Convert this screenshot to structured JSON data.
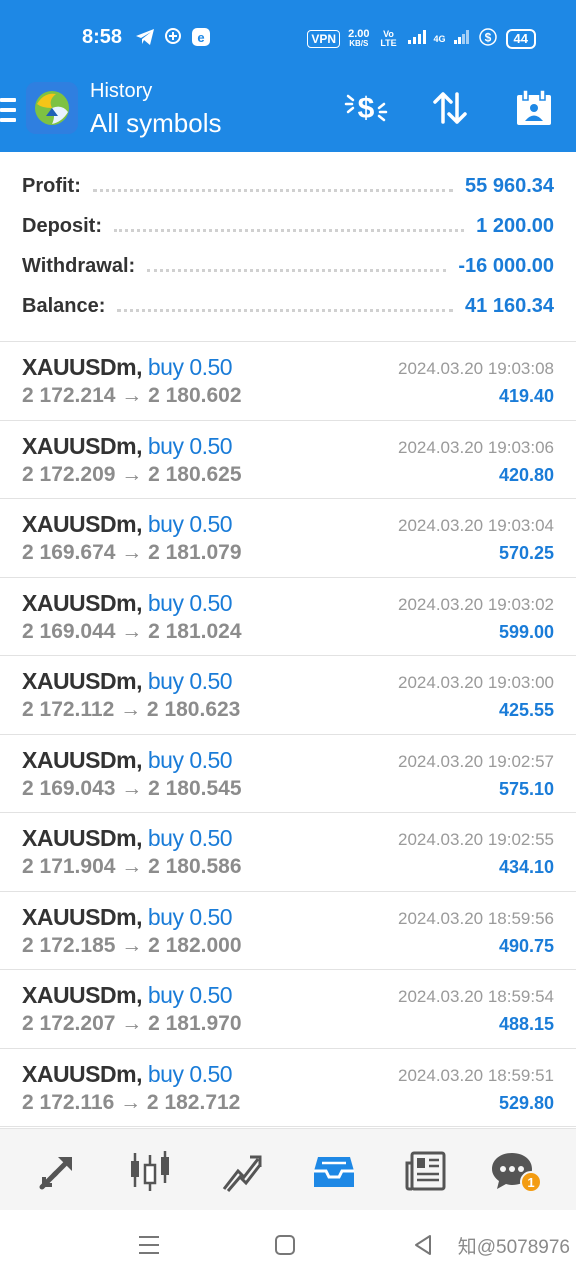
{
  "status_bar": {
    "time": "8:58",
    "vpn": "VPN",
    "speed_value": "2.00",
    "speed_unit": "KB/S",
    "network": "Vo LTE",
    "network2": "4G",
    "battery": "44"
  },
  "header": {
    "title": "History",
    "subtitle": "All symbols",
    "icons": [
      "deposit-filter-icon",
      "sort-icon",
      "calendar-icon"
    ]
  },
  "summary": {
    "profit_label": "Profit:",
    "profit_value": "55 960.34",
    "deposit_label": "Deposit:",
    "deposit_value": "1 200.00",
    "withdrawal_label": "Withdrawal:",
    "withdrawal_value": "-16 000.00",
    "balance_label": "Balance:",
    "balance_value": "41 160.34"
  },
  "deals": [
    {
      "symbol": "XAUUSDm,",
      "type": "buy 0.50",
      "prices": "2 172.214 → 2 180.602",
      "time": "2024.03.20 19:03:08",
      "profit": "419.40"
    },
    {
      "symbol": "XAUUSDm,",
      "type": "buy 0.50",
      "prices": "2 172.209 → 2 180.625",
      "time": "2024.03.20 19:03:06",
      "profit": "420.80"
    },
    {
      "symbol": "XAUUSDm,",
      "type": "buy 0.50",
      "prices": "2 169.674 → 2 181.079",
      "time": "2024.03.20 19:03:04",
      "profit": "570.25"
    },
    {
      "symbol": "XAUUSDm,",
      "type": "buy 0.50",
      "prices": "2 169.044 → 2 181.024",
      "time": "2024.03.20 19:03:02",
      "profit": "599.00"
    },
    {
      "symbol": "XAUUSDm,",
      "type": "buy 0.50",
      "prices": "2 172.112 → 2 180.623",
      "time": "2024.03.20 19:03:00",
      "profit": "425.55"
    },
    {
      "symbol": "XAUUSDm,",
      "type": "buy 0.50",
      "prices": "2 169.043 → 2 180.545",
      "time": "2024.03.20 19:02:57",
      "profit": "575.10"
    },
    {
      "symbol": "XAUUSDm,",
      "type": "buy 0.50",
      "prices": "2 171.904 → 2 180.586",
      "time": "2024.03.20 19:02:55",
      "profit": "434.10"
    },
    {
      "symbol": "XAUUSDm,",
      "type": "buy 0.50",
      "prices": "2 172.185 → 2 182.000",
      "time": "2024.03.20 18:59:56",
      "profit": "490.75"
    },
    {
      "symbol": "XAUUSDm,",
      "type": "buy 0.50",
      "prices": "2 172.207 → 2 181.970",
      "time": "2024.03.20 18:59:54",
      "profit": "488.15"
    },
    {
      "symbol": "XAUUSDm,",
      "type": "buy 0.50",
      "prices": "2 172.116 → 2 182.712",
      "time": "2024.03.20 18:59:51",
      "profit": "529.80"
    }
  ],
  "bottom_nav": {
    "items": [
      "quotes-icon",
      "chart-icon",
      "trade-icon",
      "history-icon",
      "news-icon",
      "messages-icon"
    ],
    "active": "history-icon",
    "messages_badge": "1"
  },
  "system_nav": {
    "watermark": "知@5078976"
  },
  "colors": {
    "header_bg": "#1e88e5",
    "accent_blue": "#1a7cd8",
    "badge_orange": "#f39c12"
  }
}
